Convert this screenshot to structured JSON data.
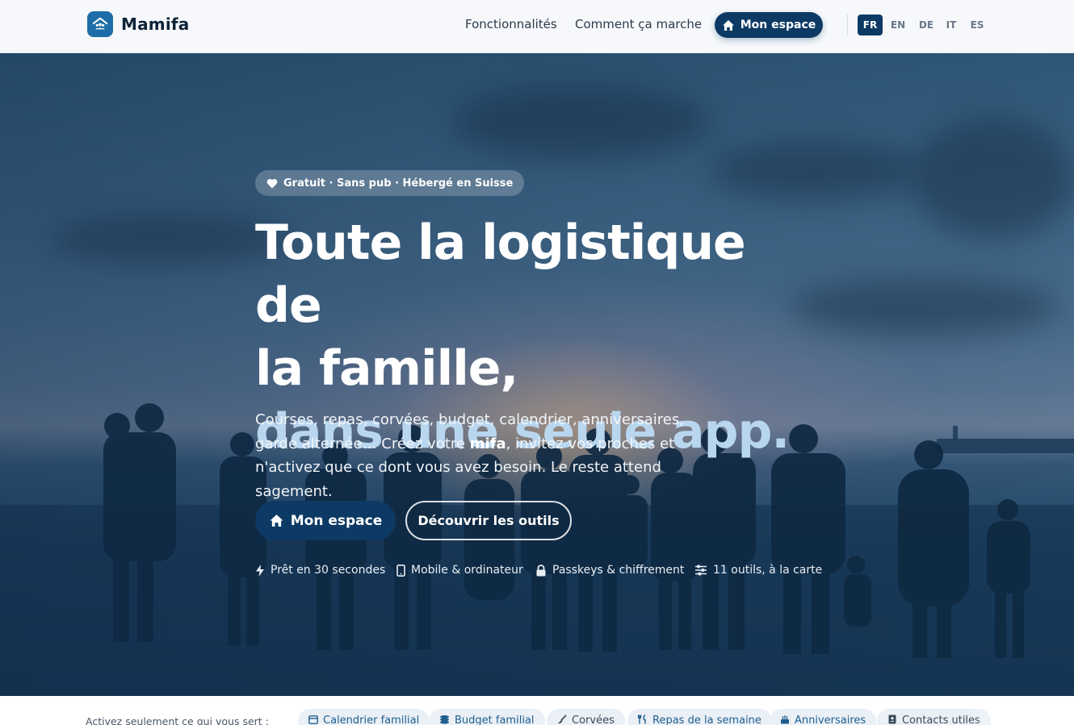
{
  "header": {
    "brand": "Mamifa",
    "nav": [
      "Fonctionnalités",
      "Comment ça marche"
    ],
    "cta": "Mon espace",
    "languages": [
      {
        "code": "FR",
        "active": true
      },
      {
        "code": "EN",
        "active": false
      },
      {
        "code": "DE",
        "active": false
      },
      {
        "code": "IT",
        "active": false
      },
      {
        "code": "ES",
        "active": false
      }
    ]
  },
  "hero": {
    "badge": "Gratuit · Sans pub · Hébergé en Suisse",
    "headline_line1": "Toute la logistique de",
    "headline_line2": "la famille,",
    "headline_accent": "dans une seule app.",
    "lead_part1": "Courses, repas, corvées, budget, calendrier, anniversaires, garde alternée… Créez votre ",
    "lead_bold": "mifa",
    "lead_part2": ", invitez vos proches et n'activez que ce dont vous avez besoin. Le reste attend sagement.",
    "primary_button": "Mon espace",
    "secondary_button": "Découvrir les outils",
    "features": [
      {
        "icon": "bolt-icon",
        "label": "Prêt en 30 secondes"
      },
      {
        "icon": "mobile-icon",
        "label": "Mobile & ordinateur"
      },
      {
        "icon": "lock-icon",
        "label": "Passkeys & chiffrement"
      },
      {
        "icon": "sliders-icon",
        "label": "11 outils, à la carte"
      }
    ]
  },
  "tools_strip": {
    "label": "Activez seulement ce qui vous sert :",
    "chips": [
      {
        "icon": "calendar-icon",
        "label": "Calendrier familial"
      },
      {
        "icon": "coins-icon",
        "label": "Budget familial"
      },
      {
        "icon": "broom-icon",
        "label": "Corvées"
      },
      {
        "icon": "utensils-icon",
        "label": "Repas de la semaine"
      },
      {
        "icon": "cake-icon",
        "label": "Anniversaires"
      },
      {
        "icon": "contact-book-icon",
        "label": "Contacts utiles"
      }
    ]
  },
  "colors": {
    "brand": "#0d3a64",
    "accent_text": "#b9d6ef",
    "chip_bg": "#eaf0f6",
    "chip_text": "#1f5e8f"
  }
}
